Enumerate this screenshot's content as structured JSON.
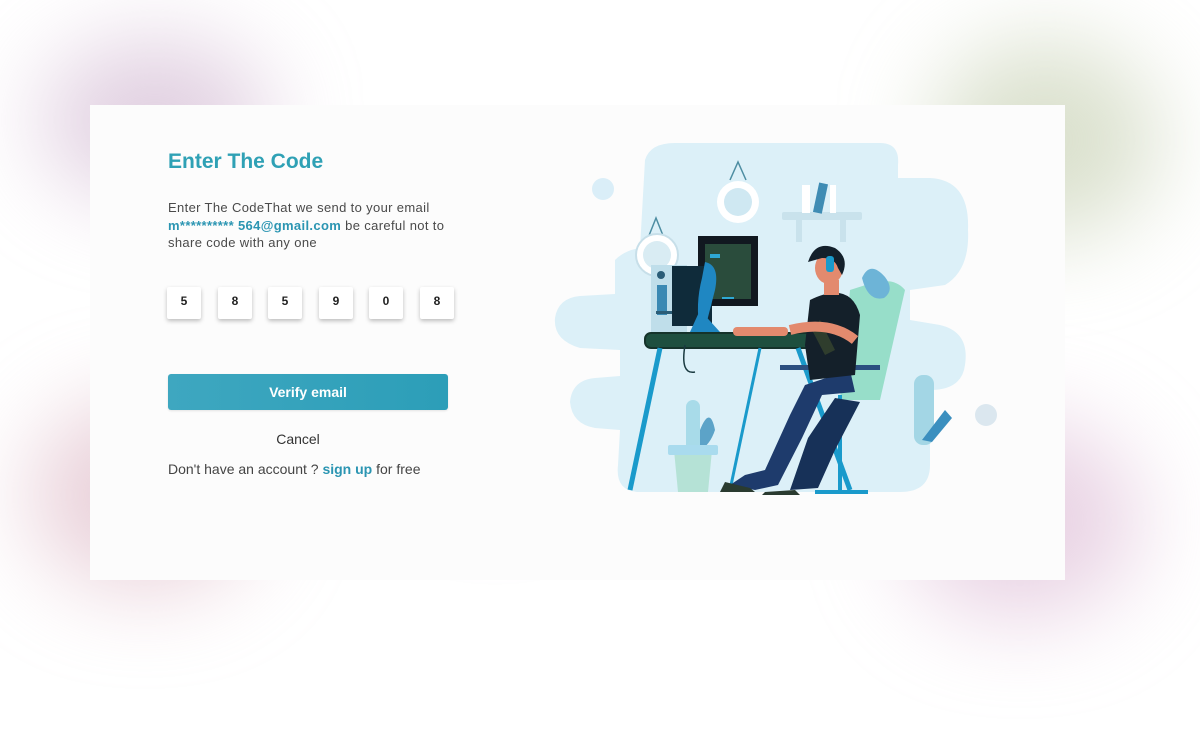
{
  "heading": "Enter The Code",
  "description": {
    "prefix": "Enter The CodeThat we send to your email",
    "email": "m********** 564@gmail.com",
    "suffix": " be careful not to share code with any one"
  },
  "otp_digits": [
    "5",
    "8",
    "5",
    "9",
    "0",
    "8"
  ],
  "verify_button": "Verify email",
  "cancel_link": "Cancel",
  "signup": {
    "prefix": "Don't have an account ? ",
    "link": "sign up",
    "suffix": " for free"
  },
  "colors": {
    "accent": "#2fa1b5",
    "button": "#36a3bc",
    "illustration_bg": "#daeef8"
  }
}
